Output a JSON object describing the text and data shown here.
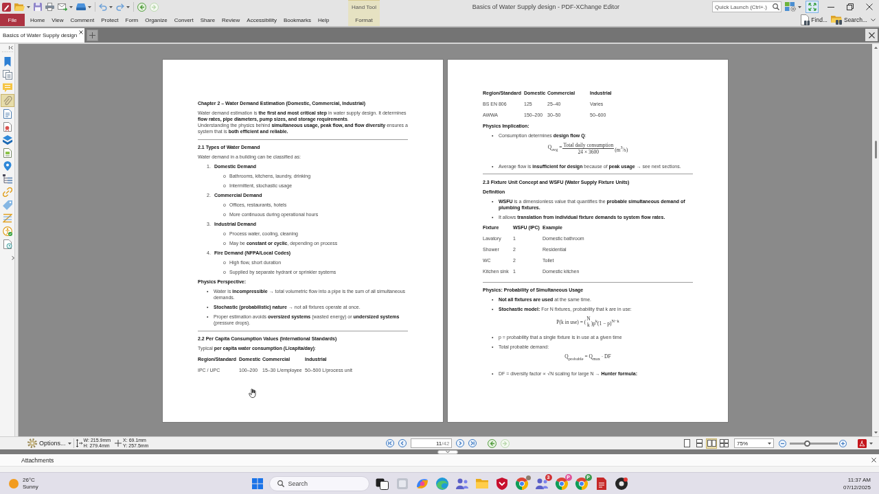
{
  "window": {
    "title": "Basics of Water Supply design - PDF-XChange Editor"
  },
  "quick_access": {
    "back": {
      "disabled": false
    },
    "forward": {
      "disabled": true
    }
  },
  "contextual_group": {
    "label": "Hand Tool"
  },
  "ribbon_tabs": [
    {
      "label": "File",
      "kind": "file",
      "selected": false
    },
    {
      "label": "Home",
      "kind": "normal",
      "selected": false
    },
    {
      "label": "View",
      "kind": "normal",
      "selected": false
    },
    {
      "label": "Comment",
      "kind": "normal",
      "selected": false
    },
    {
      "label": "Protect",
      "kind": "normal",
      "selected": false
    },
    {
      "label": "Form",
      "kind": "normal",
      "selected": false
    },
    {
      "label": "Organize",
      "kind": "normal",
      "selected": false
    },
    {
      "label": "Convert",
      "kind": "normal",
      "selected": false
    },
    {
      "label": "Share",
      "kind": "normal",
      "selected": false
    },
    {
      "label": "Review",
      "kind": "normal",
      "selected": false
    },
    {
      "label": "Accessibility",
      "kind": "normal",
      "selected": false
    },
    {
      "label": "Bookmarks",
      "kind": "normal",
      "selected": false
    },
    {
      "label": "Help",
      "kind": "normal",
      "selected": false
    },
    {
      "label": "Format",
      "kind": "contextual",
      "selected": false
    }
  ],
  "quick_launch": {
    "placeholder": "Quick Launch (Ctrl+.)"
  },
  "ribbon_commands": [
    {
      "kind": "find",
      "label": "Find..."
    },
    {
      "kind": "search",
      "label": "Search..."
    }
  ],
  "document_tabs": [
    {
      "label": "Basics of Water Supply design",
      "selected": true
    }
  ],
  "sidebar": {
    "items": [
      {
        "kind": "bookmarks",
        "selected": false
      },
      {
        "kind": "thumbnails",
        "selected": false
      },
      {
        "kind": "comments",
        "selected": false
      },
      {
        "kind": "attachments",
        "selected": true
      },
      {
        "kind": "content",
        "selected": false
      },
      {
        "kind": "signatures",
        "selected": false
      },
      {
        "kind": "layers",
        "selected": false
      },
      {
        "kind": "properties",
        "selected": false
      },
      {
        "kind": "destinations",
        "selected": false
      },
      {
        "kind": "structure",
        "selected": false
      },
      {
        "kind": "links",
        "selected": false
      },
      {
        "kind": "tags",
        "selected": false
      },
      {
        "kind": "articles",
        "selected": false
      },
      {
        "kind": "accessibility",
        "selected": false
      },
      {
        "kind": "order",
        "selected": false
      }
    ]
  },
  "pages": [
    {
      "blocks": [
        {
          "kind": "chapter",
          "text": "Chapter 2 – Water Demand Estimation (Domestic, Commercial, Industrial)"
        },
        {
          "kind": "paragraph",
          "text": "Water demand estimation is **the first and most critical step** in water supply design. It determines **flow rates, pipe diameters, pump sizes, and storage requirements**.\nUnderstanding the physics behind **simultaneous usage, peak flow, and flow diversity** ensures a system that is **both efficient and reliable.**"
        },
        {
          "kind": "rule"
        },
        {
          "kind": "heading",
          "text": "2.1 Types of Water Demand"
        },
        {
          "kind": "paragraph",
          "text": "Water demand in a building can be classified as:"
        },
        {
          "kind": "list",
          "items": [
            {
              "kind": "numbered",
              "marker": "1.",
              "text": "Domestic Demand",
              "children": [
                {
                  "kind": "sub",
                  "marker": "o",
                  "text": "Bathrooms, kitchens, laundry, drinking"
                },
                {
                  "kind": "sub",
                  "marker": "o",
                  "text": "Intermittent, stochastic usage"
                }
              ]
            },
            {
              "kind": "numbered",
              "marker": "2.",
              "text": "Commercial Demand",
              "children": [
                {
                  "kind": "sub",
                  "marker": "o",
                  "text": "Offices, restaurants, hotels"
                },
                {
                  "kind": "sub",
                  "marker": "o",
                  "text": "More continuous during operational hours"
                }
              ]
            },
            {
              "kind": "numbered",
              "marker": "3.",
              "text": "Industrial Demand",
              "children": [
                {
                  "kind": "sub",
                  "marker": "o",
                  "text": "Process water, cooling, cleaning"
                },
                {
                  "kind": "sub",
                  "marker": "o",
                  "text": "May be **constant or cyclic**, depending on process"
                }
              ]
            },
            {
              "kind": "numbered",
              "marker": "4.",
              "text": "Fire Demand (NFPA/Local Codes)",
              "children": [
                {
                  "kind": "sub",
                  "marker": "o",
                  "text": "High flow, short duration"
                },
                {
                  "kind": "sub",
                  "marker": "o",
                  "text": "Supplied by separate hydrant or sprinkler systems"
                }
              ]
            }
          ]
        },
        {
          "kind": "heading",
          "text": "Physics Perspective:"
        },
        {
          "kind": "list",
          "items": [
            {
              "kind": "bullet",
              "marker": "•",
              "text": "Water is **incompressible** → total volumetric flow into a pipe is the sum of all simultaneous demands."
            },
            {
              "kind": "bullet",
              "marker": "•",
              "text": "**Stochastic (probabilistic) nature** → not all fixtures operate at once."
            },
            {
              "kind": "bullet",
              "marker": "•",
              "text": "Proper estimation avoids **oversized systems** (wasted energy) or **undersized systems** (pressure drops)."
            }
          ]
        },
        {
          "kind": "rule"
        },
        {
          "kind": "heading",
          "text": "2.2 Per Capita Consumption Values (International Standards)"
        },
        {
          "kind": "paragraph",
          "text": "Typical **per capita water consumption (L/capita/day)**:"
        },
        {
          "kind": "table",
          "columns": [
            "Region/Standard",
            "Domestic",
            "Commercial",
            "Industrial"
          ],
          "rows": [
            [
              "IPC / UPC",
              "100–200",
              "15–30 L/employee",
              "50–500 L/process unit"
            ]
          ]
        }
      ]
    },
    {
      "blocks": [
        {
          "kind": "table",
          "columns": [
            "Region/Standard",
            "Domestic",
            "Commercial",
            "Industrial"
          ],
          "rows": [
            [
              "BS EN 806",
              "125",
              "25–40",
              "Varies"
            ],
            [
              "AWWA",
              "150–200",
              "30–50",
              "50–600"
            ]
          ]
        },
        {
          "kind": "heading",
          "text": "Physics Implication:"
        },
        {
          "kind": "list",
          "items": [
            {
              "kind": "bullet",
              "marker": "•",
              "text": "Consumption determines **design flow Q**:"
            }
          ]
        },
        {
          "kind": "fraction",
          "lhs": "Q$_{avg}$ =",
          "numerator": "Total daily consumption",
          "denominator": "24 × 3600",
          "rhs": "(m$^{3}$/s)"
        },
        {
          "kind": "list",
          "items": [
            {
              "kind": "bullet",
              "marker": "•",
              "text": "Average flow is **insufficient for design** because of **peak usage** → see next sections."
            }
          ]
        },
        {
          "kind": "rule"
        },
        {
          "kind": "heading",
          "text": "2.3 Fixture Unit Concept and WSFU (Water Supply Fixture Units)"
        },
        {
          "kind": "heading",
          "text": "Definition"
        },
        {
          "kind": "list",
          "items": [
            {
              "kind": "bullet",
              "marker": "•",
              "text": "**WSFU** is a dimensionless value that quantifies the **probable simultaneous demand of plumbing fixtures.**"
            },
            {
              "kind": "bullet",
              "marker": "•",
              "text": "It allows **translation from individual fixture demands to system flow rates.**"
            }
          ]
        },
        {
          "kind": "table",
          "columns": [
            "Fixture",
            "WSFU (IPC)",
            "Example"
          ],
          "rows": [
            [
              "Lavatory",
              "1",
              "Domestic bathroom"
            ],
            [
              "Shower",
              "2",
              "Residential"
            ],
            [
              "WC",
              "2",
              "Toilet"
            ],
            [
              "Kitchen sink",
              "1",
              "Domestic kitchen"
            ]
          ]
        },
        {
          "kind": "rule"
        },
        {
          "kind": "heading",
          "text": "Physics: Probability of Simultaneous Usage"
        },
        {
          "kind": "list",
          "items": [
            {
              "kind": "bullet",
              "marker": "•",
              "text": "**Not all fixtures are used** at the same time."
            },
            {
              "kind": "bullet",
              "marker": "•",
              "text": "**Stochastic model:** For N fixtures, probability that k are in use:"
            }
          ]
        },
        {
          "kind": "binomial",
          "lhs": "P(k in use) = (",
          "top": "N",
          "bottom": "k",
          "rhs": ")p$^{k}$(1 − p)$^{N−k}$"
        },
        {
          "kind": "list",
          "items": [
            {
              "kind": "bullet",
              "marker": "•",
              "text": "p = probability that a single fixture is in use at a given time"
            },
            {
              "kind": "bullet",
              "marker": "•",
              "text": "Total probable demand:"
            }
          ]
        },
        {
          "kind": "equation",
          "text": "Q$_{probable}$ = Q$_{max}$ · DF"
        },
        {
          "kind": "list",
          "items": [
            {
              "kind": "bullet",
              "marker": "•",
              "text": "DF = diversity factor ∝ √N scaling for large N → **Hunter formula:**"
            }
          ]
        }
      ]
    }
  ],
  "status_bar": {
    "options": "Options...",
    "width": "W: 215.9mm",
    "height": "H: 279.4mm",
    "x": "X: 69.1mm",
    "y": "Y: 257.5mm",
    "page_number": "11",
    "page_total": "/42",
    "back": {
      "disabled": false
    },
    "forward": {
      "disabled": true
    },
    "page_layouts": [
      {
        "kind": "single",
        "selected": false
      },
      {
        "kind": "scroll",
        "selected": false
      },
      {
        "kind": "facing",
        "selected": true
      },
      {
        "kind": "spread",
        "selected": false
      }
    ],
    "zoom": "75%",
    "zoom_slider": {
      "level": 0.37
    }
  },
  "attachments_pane": {
    "title": "Attachments"
  },
  "taskbar": {
    "weather": {
      "temperature": "26°C",
      "condition": "Sunny"
    },
    "search": {
      "placeholder": "Search"
    },
    "apps": [
      {
        "kind": "squares"
      },
      {
        "kind": "tablet"
      },
      {
        "kind": "swirl"
      },
      {
        "kind": "wave"
      },
      {
        "kind": "people"
      },
      {
        "kind": "folder"
      },
      {
        "kind": "shield"
      },
      {
        "kind": "browser",
        "avatar": true
      },
      {
        "kind": "people",
        "badge": "3"
      },
      {
        "kind": "browser",
        "badge": "P",
        "color": "#e0559a"
      },
      {
        "kind": "browser",
        "badge": "P",
        "color": "#3f9b4f"
      },
      {
        "kind": "document"
      },
      {
        "kind": "disc"
      }
    ],
    "time": "11:37 AM",
    "date": "07/12/2025"
  }
}
